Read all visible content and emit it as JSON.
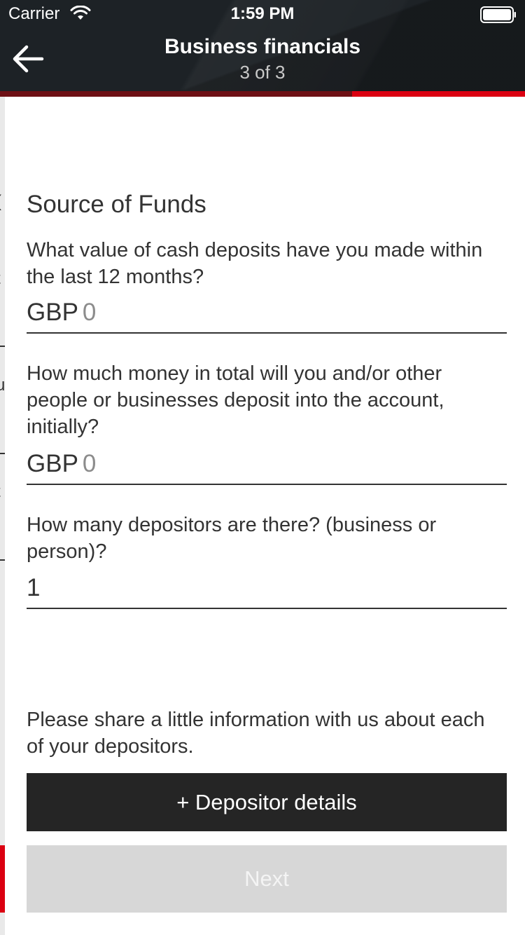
{
  "status_bar": {
    "carrier": "Carrier",
    "time": "1:59 PM",
    "wifi_icon": "wifi-icon",
    "battery_icon": "battery-icon"
  },
  "header": {
    "back_icon": "arrow-left-icon",
    "title": "Business financials",
    "step": "3 of 3",
    "progress_fraction": 0.67
  },
  "form": {
    "section_title": "Source of Funds",
    "cash_deposits": {
      "question": "What value of cash deposits have you made within the last 12 months?",
      "currency": "GBP",
      "value": "0"
    },
    "initial_deposit": {
      "question": "How much money in total will you and/or other people or businesses deposit into the account, initially?",
      "currency": "GBP",
      "value": "0"
    },
    "depositor_count": {
      "question": "How many depositors are there? (business or person)?",
      "value": "1"
    },
    "info_text": "Please share a little information with us about each of your depositors.",
    "depositor_button_label": "+ Depositor details",
    "next_button_label": "Next"
  },
  "background_panel": {
    "visible_fragments": [
      "(",
      "t",
      "u",
      "t"
    ]
  },
  "colors": {
    "header_bg": "#1d2226",
    "accent_red": "#db0011",
    "progress_done": "#6e1015",
    "text": "#333333",
    "depositor_button_bg": "#252525",
    "next_button_disabled_bg": "#d7d7d7"
  }
}
